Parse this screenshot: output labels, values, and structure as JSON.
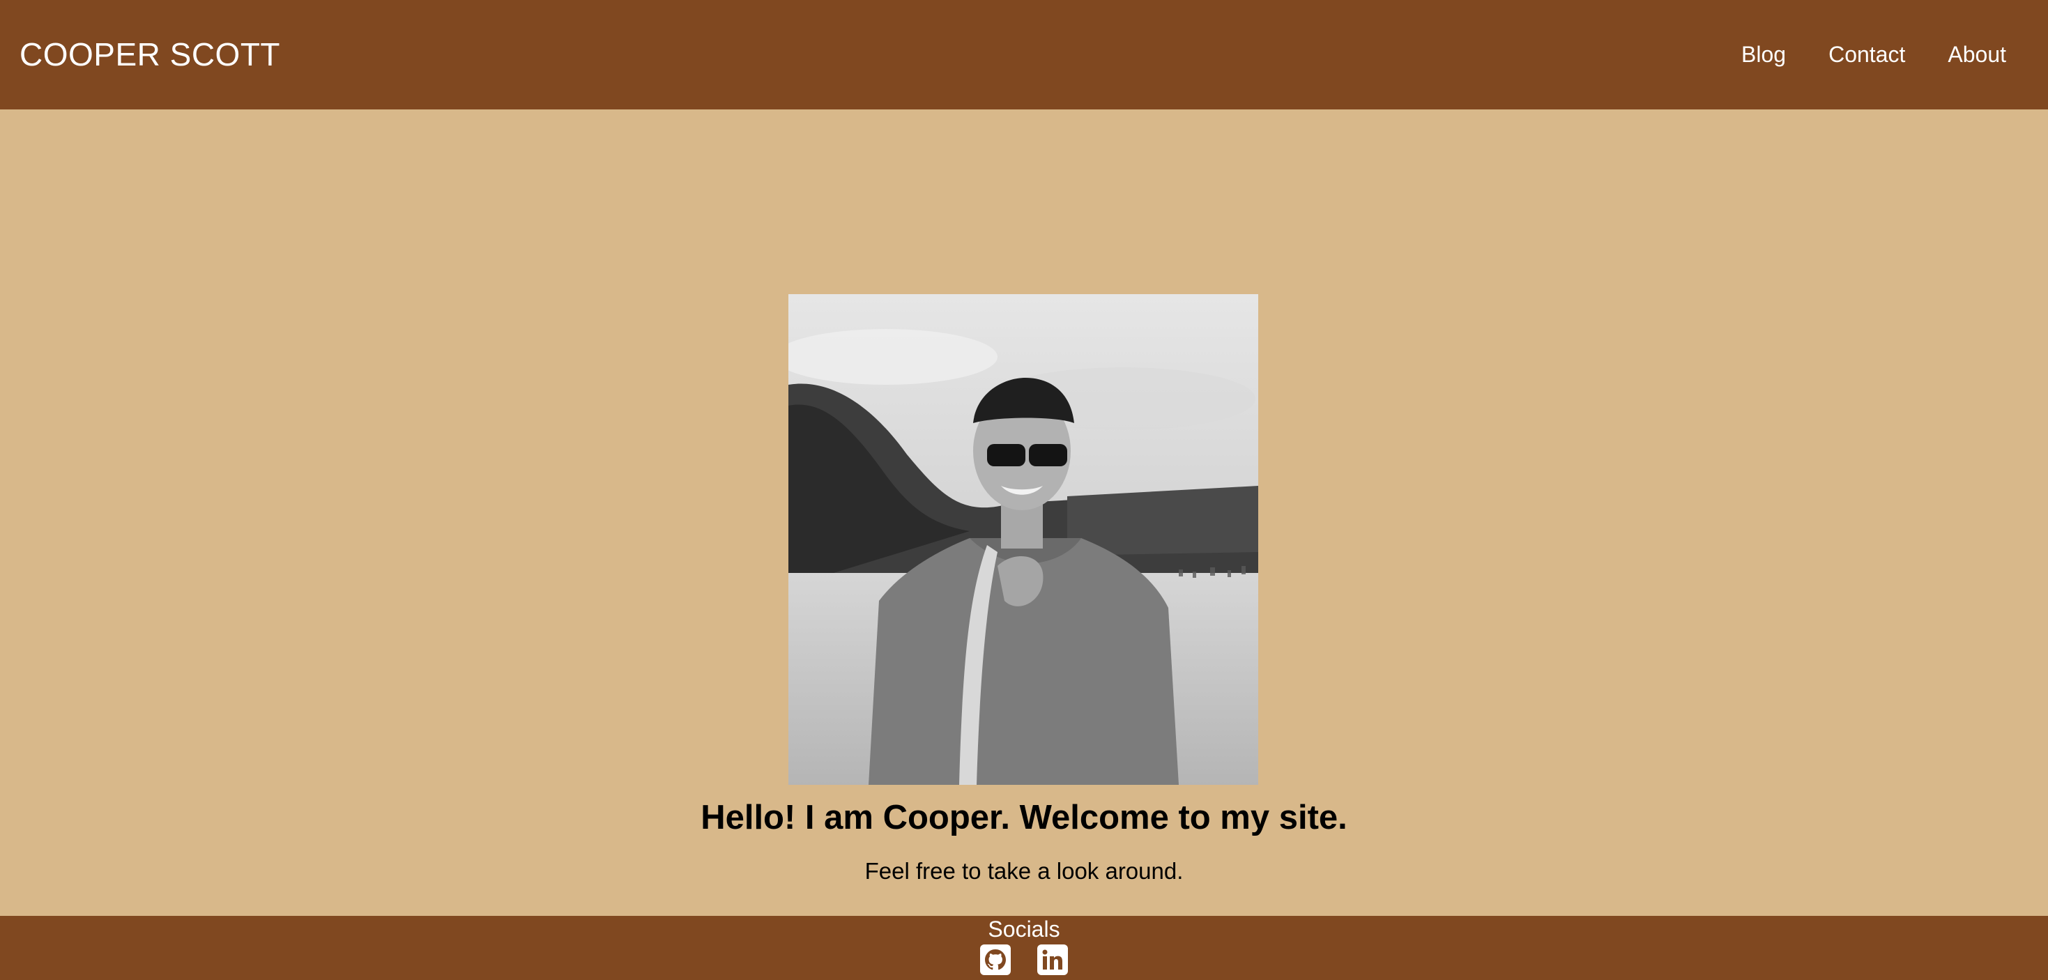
{
  "header": {
    "site_title": "COOPER SCOTT",
    "nav": [
      {
        "label": "Blog"
      },
      {
        "label": "Contact"
      },
      {
        "label": "About"
      }
    ]
  },
  "hero": {
    "headline": "Hello! I am Cooper. Welcome to my site.",
    "subtext": "Feel free to take a look around.",
    "photo_icon": "portrait-photo"
  },
  "footer": {
    "socials_label": "Socials",
    "icons": [
      "github-icon",
      "linkedin-icon"
    ]
  },
  "colors": {
    "header_bg": "#804820",
    "page_bg": "#d8b88a",
    "text_light": "#ffffff",
    "text_dark": "#000000"
  }
}
